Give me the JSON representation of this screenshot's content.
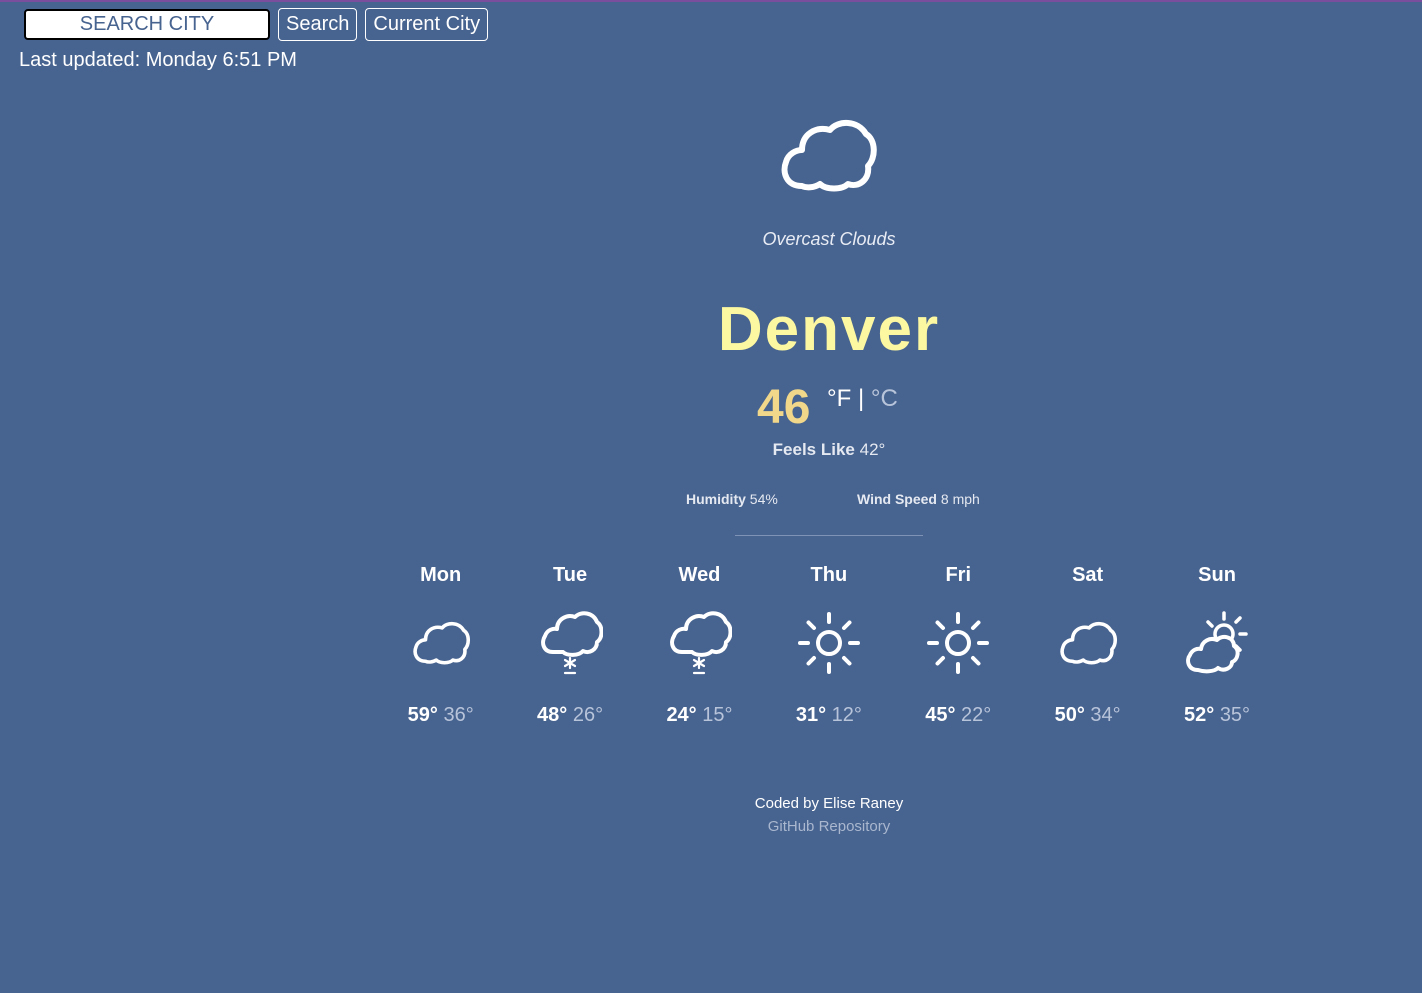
{
  "search": {
    "placeholder": "SEARCH CITY",
    "search_label": "Search",
    "current_label": "Current City"
  },
  "last_updated": "Last updated: Monday 6:51 PM",
  "current": {
    "icon": "cloud-icon",
    "description": "Overcast Clouds",
    "city": "Denver",
    "temperature": "46",
    "unit_f": "°F",
    "unit_separator": "|",
    "unit_c": "°C",
    "feels_like_label": "Feels Like",
    "feels_like_value": "42°",
    "humidity_label": "Humidity",
    "humidity_value": "54%",
    "wind_label": "Wind Speed",
    "wind_value": "8 mph"
  },
  "forecast": [
    {
      "day": "Mon",
      "icon": "cloud-icon",
      "high": "59°",
      "low": "36°"
    },
    {
      "day": "Tue",
      "icon": "snow-cloud-icon",
      "high": "48°",
      "low": "26°"
    },
    {
      "day": "Wed",
      "icon": "snow-cloud-icon",
      "high": "24°",
      "low": "15°"
    },
    {
      "day": "Thu",
      "icon": "sun-icon",
      "high": "31°",
      "low": "12°"
    },
    {
      "day": "Fri",
      "icon": "sun-icon",
      "high": "45°",
      "low": "22°"
    },
    {
      "day": "Sat",
      "icon": "cloud-icon",
      "high": "50°",
      "low": "34°"
    },
    {
      "day": "Sun",
      "icon": "partly-cloudy-icon",
      "high": "52°",
      "low": "35°"
    }
  ],
  "footer": {
    "credit": "Coded by Elise Raney",
    "repo_label": "GitHub Repository"
  },
  "colors": {
    "background": "#47638f",
    "city": "#fcf7a1",
    "temperature": "#f0d78a",
    "muted": "#b8c4da"
  }
}
